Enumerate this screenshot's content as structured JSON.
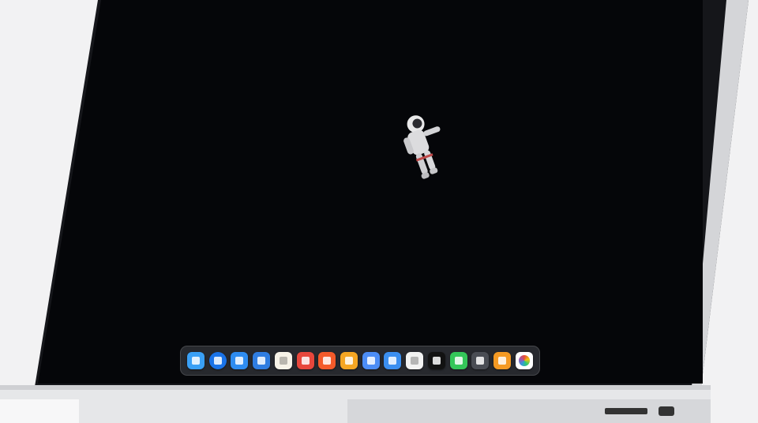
{
  "theme": {
    "backdrop": "#f2f2f3",
    "bezel": "#111215",
    "screen": "#050609",
    "chassis": "#d9dadc",
    "dock_bg": "#2a2c32"
  },
  "dock": {
    "icons": [
      {
        "name": "finder-icon",
        "color": "#3aa0f5"
      },
      {
        "name": "app-store-icon",
        "color": "#1a73e8"
      },
      {
        "name": "multi-window-icon",
        "color": "#2e8cf0"
      },
      {
        "name": "sails-icon",
        "color": "#2f7de1"
      },
      {
        "name": "notes-icon",
        "color": "#f7f3e8"
      },
      {
        "name": "hexagon-app-icon",
        "color": "#e8473c"
      },
      {
        "name": "orange-app-icon",
        "color": "#f45a2a"
      },
      {
        "name": "amber-app-icon",
        "color": "#f5a623"
      },
      {
        "name": "paper-plane-icon",
        "color": "#4c8df6"
      },
      {
        "name": "blue-folder-icon",
        "color": "#3b8ff0"
      },
      {
        "name": "document-icon",
        "color": "#f2f2f2"
      },
      {
        "name": "terminal-icon",
        "color": "#121212"
      },
      {
        "name": "messages-icon",
        "color": "#34c759"
      },
      {
        "name": "cube-icon",
        "color": "#4a4d54"
      },
      {
        "name": "orange-star-icon",
        "color": "#f59a23"
      },
      {
        "name": "multicolor-flower-icon",
        "color": "#ffffff"
      }
    ]
  }
}
